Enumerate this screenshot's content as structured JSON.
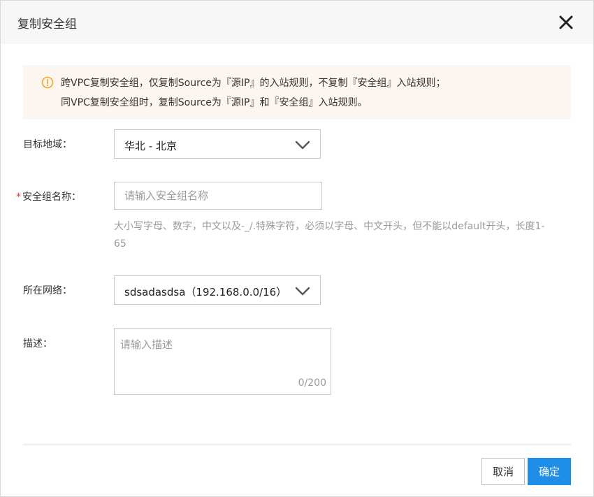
{
  "dialog": {
    "title": "复制安全组"
  },
  "notice": {
    "icon": "warning-circle-icon",
    "color": "#f5a623",
    "line1": "跨VPC复制安全组，仅复制Source为『源IP』的入站规则，不复制『安全组』入站规则；",
    "line2": "同VPC复制安全组时，复制Source为『源IP』和『安全组』入站规则。"
  },
  "form": {
    "region": {
      "label": "目标地域：",
      "value": "华北 - 北京"
    },
    "name": {
      "required_mark": "*",
      "label": "安全组名称：",
      "placeholder": "请输入安全组名称",
      "value": "",
      "hint": "大小写字母、数字，中文以及-_/.特殊字符，必须以字母、中文开头，但不能以default开头，长度1-65"
    },
    "vpc": {
      "label": "所在网络：",
      "value": "sdsadasdsa（192.168.0.0/16）"
    },
    "description": {
      "label": "描述：",
      "placeholder": "请输入描述",
      "value": "",
      "counter": "0/200"
    }
  },
  "footer": {
    "cancel_label": "取消",
    "ok_label": "确定",
    "primary_color": "#1e8ee8"
  }
}
